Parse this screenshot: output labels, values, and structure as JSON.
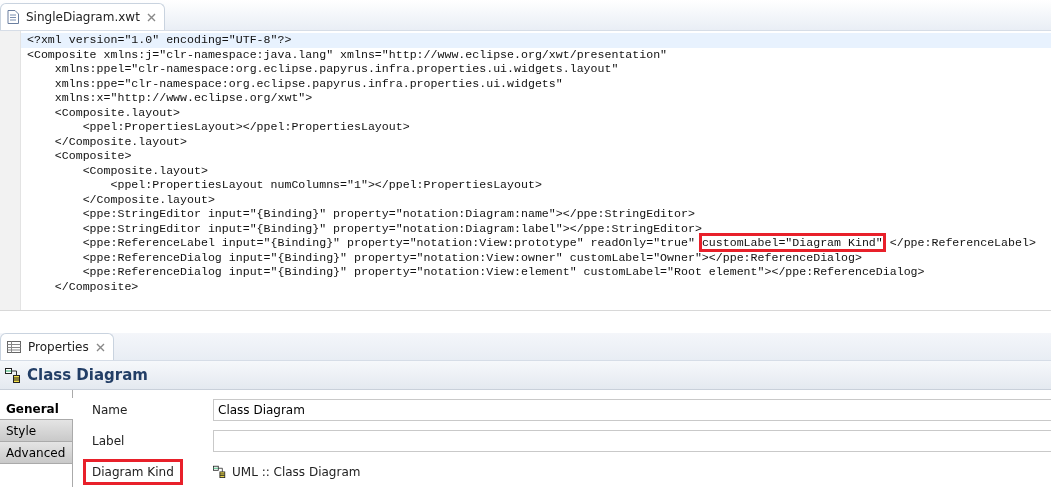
{
  "editor": {
    "tab": {
      "title": "SingleDiagram.xwt",
      "selected": true
    },
    "lines": [
      {
        "segments": [
          {
            "text": "<?xml version=\"1.0\" encoding=\"UTF-8\"?>",
            "highlighted": false
          }
        ],
        "current": true
      },
      {
        "segments": [
          {
            "text": "<Composite xmlns:j=\"clr-namespace:java.lang\" xmlns=\"http://www.eclipse.org/xwt/presentation\"",
            "highlighted": false
          }
        ],
        "current": false
      },
      {
        "segments": [
          {
            "text": "    xmlns:ppel=\"clr-namespace:org.eclipse.papyrus.infra.properties.ui.widgets.layout\"",
            "highlighted": false
          }
        ],
        "current": false
      },
      {
        "segments": [
          {
            "text": "    xmlns:ppe=\"clr-namespace:org.eclipse.papyrus.infra.properties.ui.widgets\"",
            "highlighted": false
          }
        ],
        "current": false
      },
      {
        "segments": [
          {
            "text": "    xmlns:x=\"http://www.eclipse.org/xwt\">",
            "highlighted": false
          }
        ],
        "current": false
      },
      {
        "segments": [
          {
            "text": "    <Composite.layout>",
            "highlighted": false
          }
        ],
        "current": false
      },
      {
        "segments": [
          {
            "text": "        <ppel:PropertiesLayout></ppel:PropertiesLayout>",
            "highlighted": false
          }
        ],
        "current": false
      },
      {
        "segments": [
          {
            "text": "    </Composite.layout>",
            "highlighted": false
          }
        ],
        "current": false
      },
      {
        "segments": [
          {
            "text": "    <Composite>",
            "highlighted": false
          }
        ],
        "current": false
      },
      {
        "segments": [
          {
            "text": "        <Composite.layout>",
            "highlighted": false
          }
        ],
        "current": false
      },
      {
        "segments": [
          {
            "text": "            <ppel:PropertiesLayout numColumns=\"1\"></ppel:PropertiesLayout>",
            "highlighted": false
          }
        ],
        "current": false
      },
      {
        "segments": [
          {
            "text": "        </Composite.layout>",
            "highlighted": false
          }
        ],
        "current": false
      },
      {
        "segments": [
          {
            "text": "        <ppe:StringEditor input=\"{Binding}\" property=\"notation:Diagram:name\"></ppe:StringEditor>",
            "highlighted": false
          }
        ],
        "current": false
      },
      {
        "segments": [
          {
            "text": "        <ppe:StringEditor input=\"{Binding}\" property=\"notation:Diagram:label\"></ppe:StringEditor>",
            "highlighted": false
          }
        ],
        "current": false
      },
      {
        "segments": [
          {
            "text": "        <ppe:ReferenceLabel input=\"{Binding}\" property=\"notation:View:prototype\" readOnly=\"true\" ",
            "highlighted": false
          },
          {
            "text": "customLabel=\"Diagram Kind\"",
            "highlighted": true
          },
          {
            "text": " </ppe:ReferenceLabel>",
            "highlighted": false
          }
        ],
        "current": false
      },
      {
        "segments": [
          {
            "text": "        <ppe:ReferenceDialog input=\"{Binding}\" property=\"notation:View:owner\" customLabel=\"Owner\"></ppe:ReferenceDialog>",
            "highlighted": false
          }
        ],
        "current": false
      },
      {
        "segments": [
          {
            "text": "        <ppe:ReferenceDialog input=\"{Binding}\" property=\"notation:View:element\" customLabel=\"Root element\"></ppe:ReferenceDialog>",
            "highlighted": false
          }
        ],
        "current": false
      },
      {
        "segments": [
          {
            "text": "    </Composite>",
            "highlighted": false
          }
        ],
        "current": false
      }
    ]
  },
  "properties": {
    "tab": {
      "title": "Properties",
      "selected": true
    },
    "title": "Class Diagram",
    "sections": [
      {
        "label": "General",
        "selected": true
      },
      {
        "label": "Style",
        "selected": false
      },
      {
        "label": "Advanced",
        "selected": false
      }
    ],
    "fields": [
      {
        "kind": "text",
        "label": "Name",
        "value": "Class Diagram",
        "highlighted": false
      },
      {
        "kind": "text",
        "label": "Label",
        "highlighted": false
      },
      {
        "kind": "reference",
        "label": "Diagram Kind",
        "value": "UML :: Class Diagram",
        "highlighted": true
      }
    ]
  }
}
